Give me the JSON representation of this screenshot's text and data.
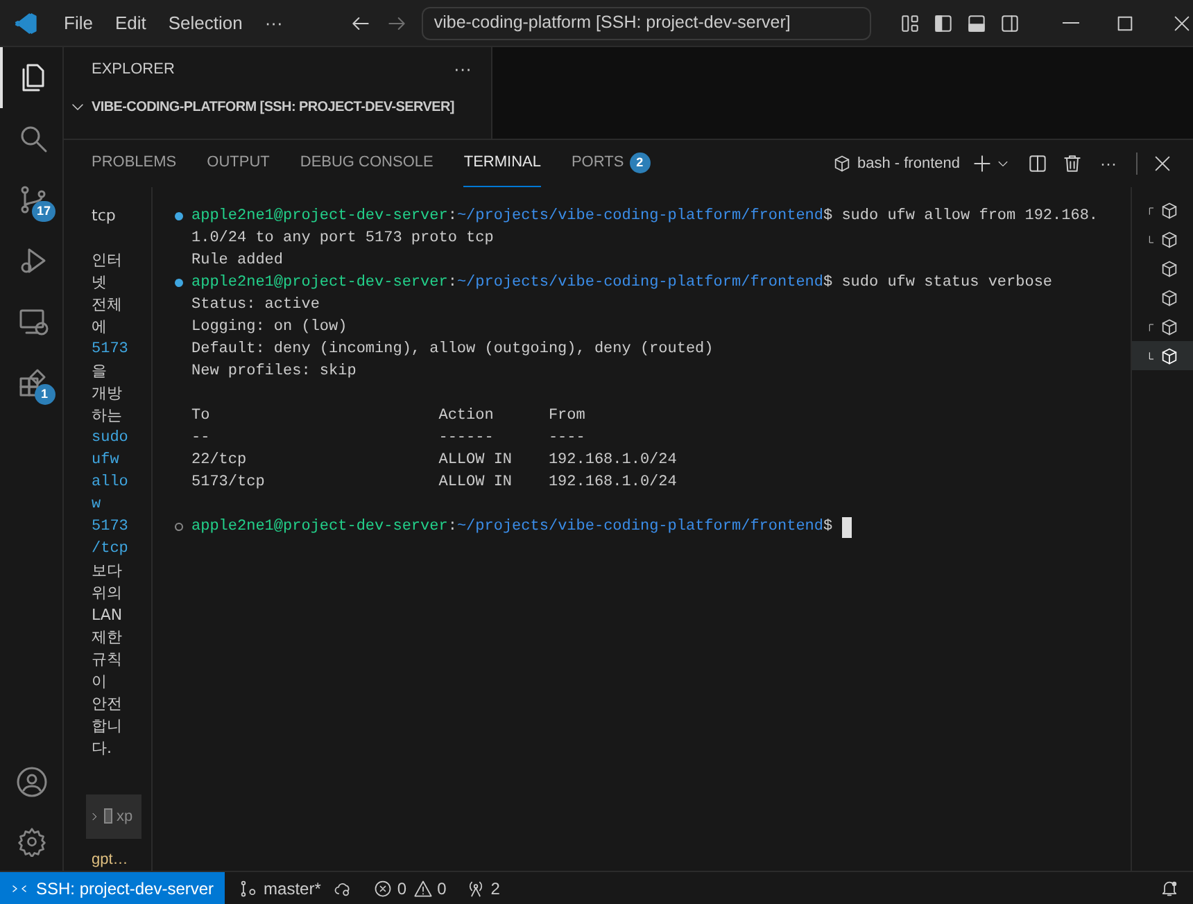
{
  "title_bar": {
    "menus": [
      "File",
      "Edit",
      "Selection",
      "···"
    ],
    "command_center": "vibe-coding-platform [SSH: project-dev-server]"
  },
  "activity_bar": [
    {
      "kind": "explorer",
      "selected": true
    },
    {
      "kind": "search",
      "selected": false
    },
    {
      "kind": "source-control",
      "selected": false,
      "badge": "17"
    },
    {
      "kind": "run-debug",
      "selected": false
    },
    {
      "kind": "remote",
      "selected": false
    },
    {
      "kind": "extensions",
      "selected": false,
      "badge": "1"
    }
  ],
  "sidebar": {
    "title": "EXPLORER",
    "more": "···",
    "root": "VIBE-CODING-PLATFORM [SSH: PROJECT-DEV-SERVER]"
  },
  "panel": {
    "tabs": [
      {
        "label": "PROBLEMS",
        "selected": false
      },
      {
        "label": "OUTPUT",
        "selected": false
      },
      {
        "label": "DEBUG CONSOLE",
        "selected": false
      },
      {
        "label": "TERMINAL",
        "selected": true
      },
      {
        "label": "PORTS",
        "selected": false,
        "badge": "2"
      }
    ],
    "terminal_name": "bash - frontend",
    "more": "···"
  },
  "chat_column": {
    "lines": [
      {
        "text": "tcp",
        "kind": "plain"
      },
      {
        "text": "인터",
        "kind": "plain"
      },
      {
        "text": "넷",
        "kind": "plain"
      },
      {
        "text": "전체",
        "kind": "plain"
      },
      {
        "text": "에",
        "kind": "plain"
      },
      {
        "text": "5173",
        "kind": "code"
      },
      {
        "text": "을",
        "kind": "plain"
      },
      {
        "text": "개방",
        "kind": "plain"
      },
      {
        "text": "하는",
        "kind": "plain"
      },
      {
        "text": "sudo",
        "kind": "code"
      },
      {
        "text": "ufw",
        "kind": "code"
      },
      {
        "text": "allo",
        "kind": "code"
      },
      {
        "text": "w",
        "kind": "code"
      },
      {
        "text": "5173",
        "kind": "code"
      },
      {
        "text": "/tcp",
        "kind": "code"
      },
      {
        "text": "보다",
        "kind": "plain"
      },
      {
        "text": "위의",
        "kind": "plain"
      },
      {
        "text": "LAN",
        "kind": "plain"
      },
      {
        "text": "제한",
        "kind": "plain"
      },
      {
        "text": "규칙",
        "kind": "plain"
      },
      {
        "text": "이",
        "kind": "plain"
      },
      {
        "text": "안전",
        "kind": "plain"
      },
      {
        "text": "합니",
        "kind": "plain"
      },
      {
        "text": "다.",
        "kind": "plain"
      }
    ],
    "collapsed_item": "xp",
    "footer": "gpt…"
  },
  "terminal": {
    "lines": [
      {
        "kind": "prompt",
        "completed": true,
        "user": "apple2ne1@project-dev-server",
        "separator": ":",
        "path": "~/projects/vibe-coding-platform/frontend",
        "symbol": "$",
        "command": "sudo ufw allow from 192.168."
      },
      {
        "kind": "output",
        "text": "1.0/24 to any port 5173 proto tcp"
      },
      {
        "kind": "output",
        "text": "Rule added"
      },
      {
        "kind": "prompt",
        "completed": true,
        "user": "apple2ne1@project-dev-server",
        "separator": ":",
        "path": "~/projects/vibe-coding-platform/frontend",
        "symbol": "$",
        "command": "sudo ufw status verbose"
      },
      {
        "kind": "output",
        "text": "Status: active"
      },
      {
        "kind": "output",
        "text": "Logging: on (low)"
      },
      {
        "kind": "output",
        "text": "Default: deny (incoming), allow (outgoing), deny (routed)"
      },
      {
        "kind": "output",
        "text": "New profiles: skip"
      },
      {
        "kind": "blank"
      },
      {
        "kind": "output",
        "text": "To                         Action      From"
      },
      {
        "kind": "output",
        "text": "--                         ------      ----"
      },
      {
        "kind": "output",
        "text": "22/tcp                     ALLOW IN    192.168.1.0/24"
      },
      {
        "kind": "output",
        "text": "5173/tcp                   ALLOW IN    192.168.1.0/24"
      },
      {
        "kind": "blank"
      },
      {
        "kind": "prompt",
        "completed": false,
        "user": "apple2ne1@project-dev-server",
        "separator": ":",
        "path": "~/projects/vibe-coding-platform/frontend",
        "symbol": "$",
        "cursor": true
      }
    ]
  },
  "terminal_list": [
    {
      "group_start": true,
      "group_end": false,
      "selected": false
    },
    {
      "group_start": false,
      "group_end": true,
      "selected": false
    },
    {
      "group_start": false,
      "group_end": false,
      "selected": false
    },
    {
      "group_start": false,
      "group_end": false,
      "selected": false
    },
    {
      "group_start": true,
      "group_end": false,
      "selected": false
    },
    {
      "group_start": false,
      "group_end": true,
      "selected": true
    }
  ],
  "status_bar": {
    "remote": "SSH: project-dev-server",
    "branch": "master*",
    "errors": "0",
    "warnings": "0",
    "ports": "2"
  }
}
